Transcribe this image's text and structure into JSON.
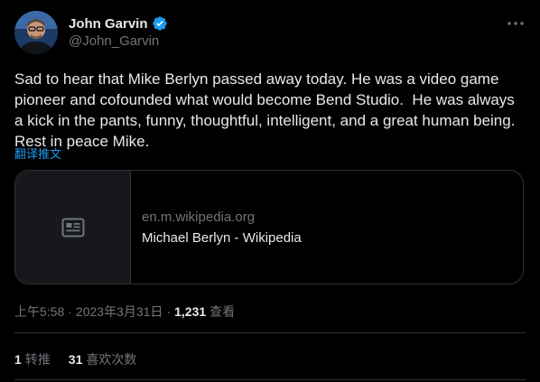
{
  "tweet": {
    "author": {
      "display_name": "John Garvin",
      "handle": "@John_Garvin",
      "verified": true
    },
    "text": "Sad to hear that Mike Berlyn passed away today. He was a video game pioneer and cofounded what would become Bend Studio.  He was always a kick in the pants, funny, thoughtful, intelligent, and a great human being. Rest in peace Mike.",
    "translate_label": "翻译推文",
    "link_card": {
      "domain": "en.m.wikipedia.org",
      "title": "Michael Berlyn - Wikipedia",
      "thumbnail_icon": "article-icon"
    },
    "meta": {
      "time": "上午5:58",
      "date": "2023年3月31日",
      "views_count": "1,231",
      "views_label": "查看"
    },
    "stats": {
      "retweets_count": "1",
      "retweets_label": "转推",
      "likes_count": "31",
      "likes_label": "喜欢次数"
    }
  },
  "colors": {
    "background": "#000000",
    "primary_text": "#e7e9ea",
    "secondary_text": "#71767b",
    "accent": "#1d9bf0",
    "border": "#2f3336"
  }
}
